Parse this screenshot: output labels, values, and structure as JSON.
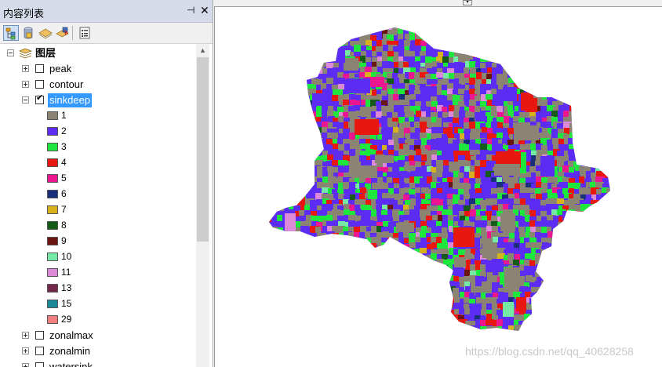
{
  "panel": {
    "title": "内容列表",
    "pin_glyph": "⊣",
    "close_glyph": "✕"
  },
  "toolbar": {
    "buttons": [
      {
        "name": "list-by-drawing-order-icon",
        "active": true
      },
      {
        "name": "list-by-source-icon",
        "active": false
      },
      {
        "name": "list-by-visibility-icon",
        "active": false
      },
      {
        "name": "list-by-selection-icon",
        "active": false
      },
      {
        "name": "options-icon",
        "active": false
      }
    ]
  },
  "tree": {
    "root_label": "图层",
    "layers": [
      {
        "name": "peak",
        "checked": false,
        "expanded": false
      },
      {
        "name": "contour",
        "checked": false,
        "expanded": false
      },
      {
        "name": "sinkdeep",
        "checked": true,
        "expanded": true,
        "selected": true
      }
    ],
    "legend": [
      {
        "label": "1",
        "color": "#8b8472"
      },
      {
        "label": "2",
        "color": "#5c2cf2"
      },
      {
        "label": "3",
        "color": "#1de63c"
      },
      {
        "label": "4",
        "color": "#e8170f"
      },
      {
        "label": "5",
        "color": "#ec1690"
      },
      {
        "label": "6",
        "color": "#1a2f7a"
      },
      {
        "label": "7",
        "color": "#d8b21e"
      },
      {
        "label": "8",
        "color": "#145a18"
      },
      {
        "label": "9",
        "color": "#6a1510"
      },
      {
        "label": "10",
        "color": "#74eaa6"
      },
      {
        "label": "11",
        "color": "#dc8ad8"
      },
      {
        "label": "13",
        "color": "#73274a"
      },
      {
        "label": "15",
        "color": "#1a8a9a"
      },
      {
        "label": "29",
        "color": "#f08080"
      }
    ],
    "after_layers": [
      {
        "name": "zonalmax",
        "checked": false
      },
      {
        "name": "zonalmin",
        "checked": false
      },
      {
        "name": "watersink",
        "checked": false
      }
    ]
  },
  "scrollbar": {
    "up_glyph": "▲"
  },
  "map": {
    "colors": [
      "#8b8472",
      "#5c2cf2",
      "#1de63c",
      "#e8170f",
      "#ec1690",
      "#1a2f7a",
      "#d8b21e",
      "#145a18",
      "#6a1510",
      "#74eaa6",
      "#dc8ad8"
    ],
    "dropdown_glyph": "▾"
  },
  "watermark": "https://blog.csdn.net/qq_40628258"
}
